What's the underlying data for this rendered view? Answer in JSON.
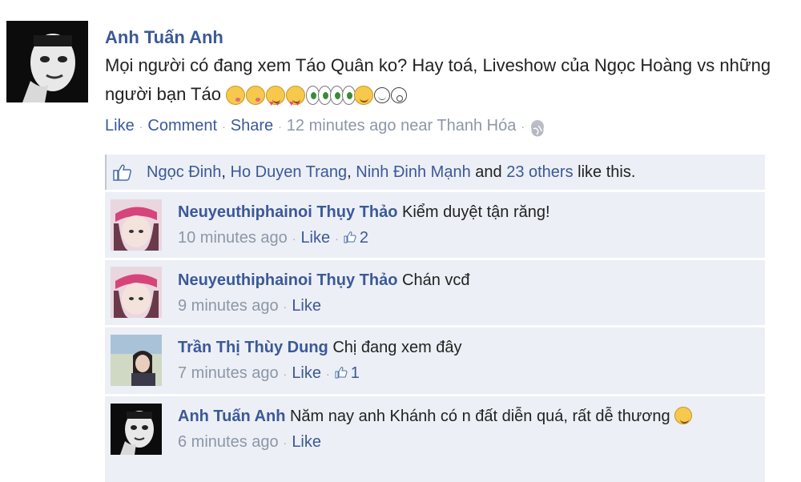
{
  "post": {
    "author": "Anh Tuấn Anh",
    "text": "Mọi người có đang xem Táo Quân ko? Hay toá, Liveshow của Ngọc Hoàng vs những người bạn Táo",
    "emoticons": [
      "kiss-face-icon",
      "kiss-face-icon",
      "heart-eyes-icon",
      "heart-eyes-icon",
      "eyes-icon",
      "eyes-icon",
      "eyes-icon",
      "eyes-icon",
      "smile-icon",
      "smile-outline-icon",
      "surprised-outline-icon"
    ],
    "actions": {
      "like": "Like",
      "comment": "Comment",
      "share": "Share",
      "time": "12 minutes ago",
      "location_prefix": "near",
      "location": "Thanh Hóa",
      "privacy_icon": "globe-icon"
    }
  },
  "likes": {
    "icon": "thumbs-up-icon",
    "names": [
      "Ngọc Đinh",
      "Ho Duyen Trang",
      "Ninh Đinh Mạnh"
    ],
    "separator": ",",
    "and": "and",
    "others": "23 others",
    "suffix": "like this."
  },
  "comments": [
    {
      "author": "Neuyeuthiphainoi Thụy Thảo",
      "text": "Kiểm duyệt tận răng!",
      "time": "10 minutes ago",
      "like": "Like",
      "like_count": "2"
    },
    {
      "author": "Neuyeuthiphainoi Thụy Thảo",
      "text": "Chán vcđ",
      "time": "9 minutes ago",
      "like": "Like",
      "like_count": ""
    },
    {
      "author": "Trần Thị Thùy Dung",
      "text": "Chị đang xem đây",
      "time": "7 minutes ago",
      "like": "Like",
      "like_count": "1"
    },
    {
      "author": "Anh Tuấn Anh",
      "text": "Năm nay anh Khánh có n đất diễn quá, rất dễ thương",
      "time": "6 minutes ago",
      "like": "Like",
      "like_count": ""
    }
  ],
  "colors": {
    "link": "#3b5998",
    "meta": "#8c97a8",
    "panel": "#eceff5"
  }
}
